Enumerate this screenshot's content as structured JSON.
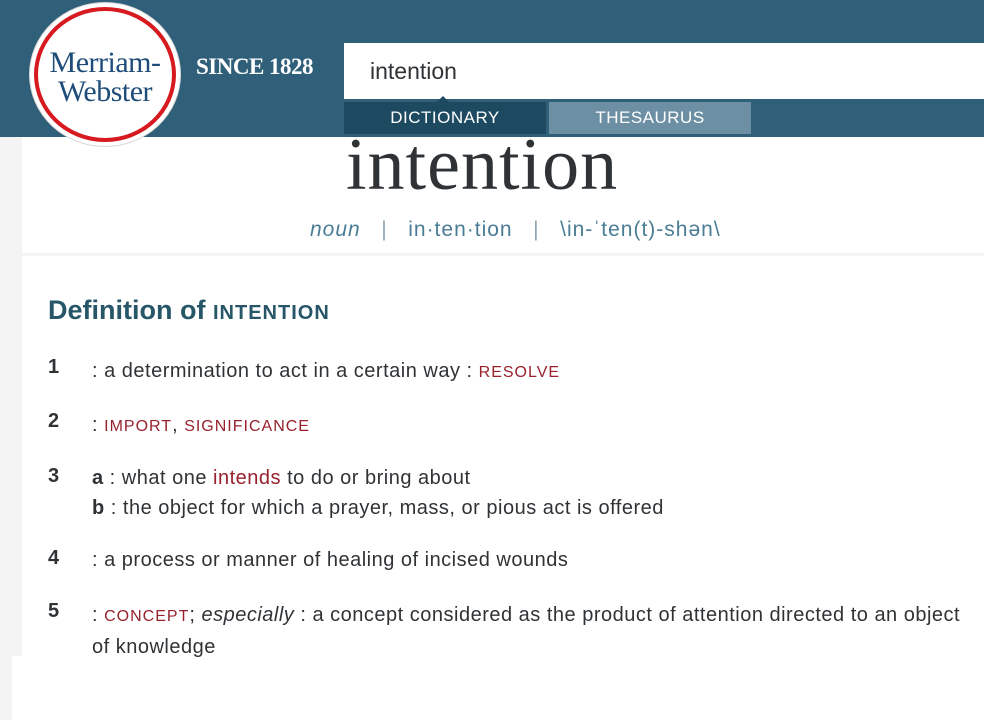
{
  "header": {
    "logo_line1": "Merriam-",
    "logo_line2": "Webster",
    "since": "SINCE 1828",
    "search_value": "intention",
    "tabs": [
      "DICTIONARY",
      "THESAURUS"
    ]
  },
  "entry": {
    "headword": "intention",
    "pos": "noun",
    "syllables": "in·ten·tion",
    "pronunciation": "\\in-ˈten(t)-shən\\",
    "separator": "|"
  },
  "definitions": {
    "title": "Definition of",
    "title_word": "INTENTION",
    "senses": [
      {
        "num": "1",
        "text": ": a determination to act in a certain way : ",
        "xref": "RESOLVE"
      },
      {
        "num": "2",
        "prefix": ": ",
        "xref1": "IMPORT",
        "comma": ", ",
        "xref2": "SIGNIFICANCE"
      },
      {
        "num": "3",
        "a_letter": "a",
        "a_text1": " : what one ",
        "a_link": "intends",
        "a_text2": " to do or bring about",
        "b_letter": "b",
        "b_text": " : the object for which a prayer, mass, or pious act is offered"
      },
      {
        "num": "4",
        "text": ": a process or manner of healing of incised wounds"
      },
      {
        "num": "5",
        "prefix": ": ",
        "xref": "CONCEPT",
        "semi": "; ",
        "especially": "especially",
        "text": " : a concept considered as the product of attention directed to an object of knowledge"
      }
    ]
  },
  "colors": {
    "header_bg": "#305f7a",
    "tab_active": "#1d4a61",
    "tab_inactive": "#6d8fa4",
    "xref": "#97212d",
    "logo_red": "#d71920",
    "logo_blue": "#1f4d79"
  }
}
